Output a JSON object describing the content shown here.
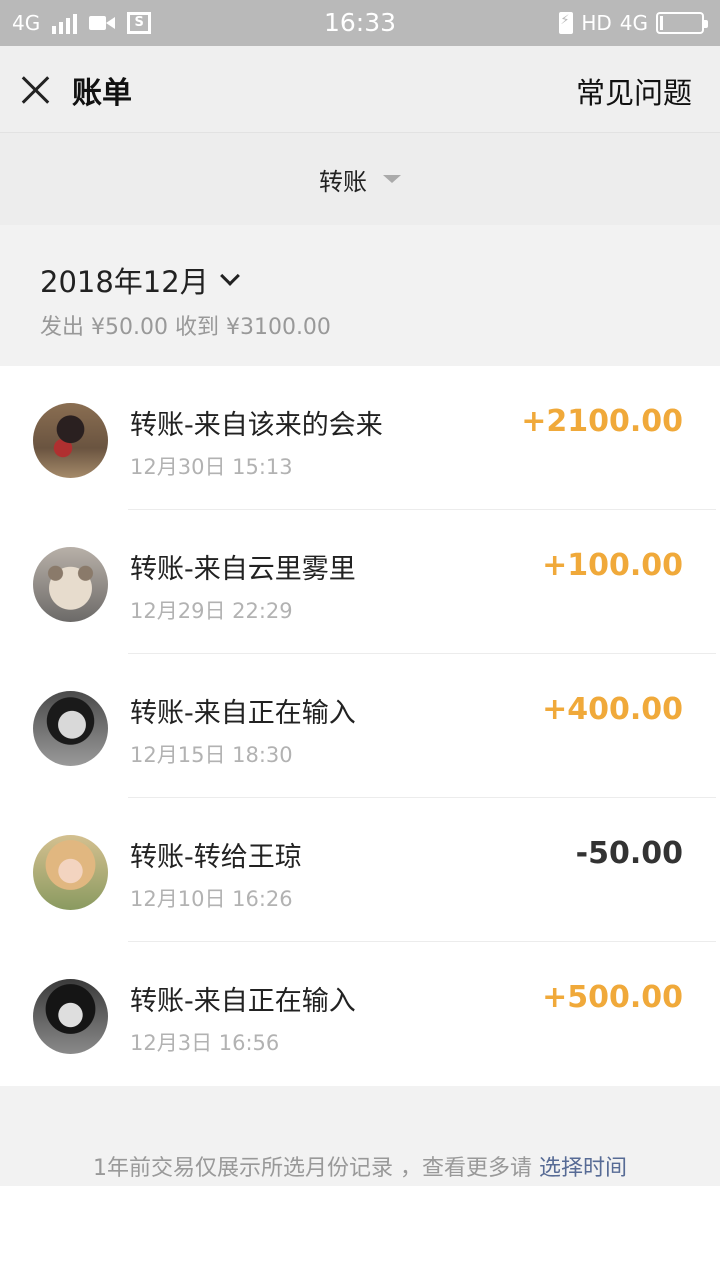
{
  "status_bar": {
    "network": "4G",
    "time": "16:33",
    "hd": "HD",
    "network_right": "4G"
  },
  "nav": {
    "title": "账单",
    "faq": "常见问题"
  },
  "filter": {
    "label": "转账"
  },
  "month": {
    "title": "2018年12月",
    "summary": "发出 ¥50.00 收到 ¥3100.00"
  },
  "transactions": [
    {
      "title": "转账-来自该来的会来",
      "date": "12月30日 15:13",
      "amount": "+2100.00",
      "type": "income"
    },
    {
      "title": "转账-来自云里雾里",
      "date": "12月29日 22:29",
      "amount": "+100.00",
      "type": "income"
    },
    {
      "title": "转账-来自正在输入",
      "date": "12月15日 18:30",
      "amount": "+400.00",
      "type": "income"
    },
    {
      "title": "转账-转给王琼",
      "date": "12月10日 16:26",
      "amount": "-50.00",
      "type": "expense"
    },
    {
      "title": "转账-来自正在输入",
      "date": "12月3日 16:56",
      "amount": "+500.00",
      "type": "income"
    }
  ],
  "footer": {
    "note": "1年前交易仅展示所选月份记录 ，查看更多请 ",
    "link": "选择时间"
  },
  "colors": {
    "income": "#f0a93a",
    "expense": "#333333",
    "link": "#576b95"
  }
}
